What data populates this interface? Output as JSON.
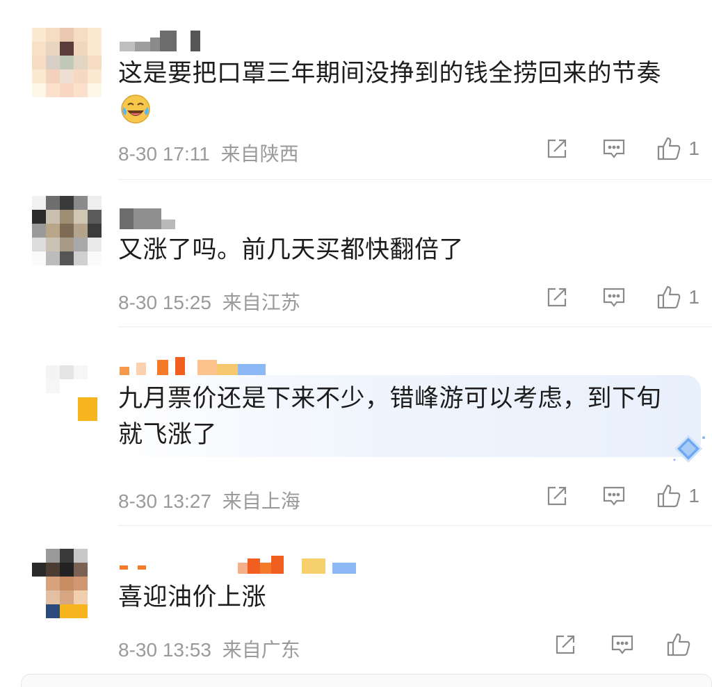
{
  "comments": [
    {
      "text_lines": [
        "这是要把口罩三年期间没挣到的钱全捞回来的节奏"
      ],
      "has_emoji": true,
      "emoji_name": "laugh-cry-emoji",
      "date": "8-30",
      "time": "17:11",
      "location": "来自陕西",
      "like_count": "1"
    },
    {
      "text_lines": [
        "又涨了吗。前几天买都快翻倍了"
      ],
      "date": "8-30",
      "time": "15:25",
      "location": "来自江苏",
      "like_count": "1"
    },
    {
      "text_lines": [
        "九月票价还是下来不少，错峰游可以考虑，到下旬",
        "就飞涨了"
      ],
      "date": "8-30",
      "time": "13:27",
      "location": "来自上海",
      "like_count": "1"
    },
    {
      "text_lines": [
        "喜迎油价上涨"
      ],
      "date": "8-30",
      "time": "13:53",
      "location": "来自广东",
      "like_count": ""
    }
  ],
  "icons": {
    "share": "share-icon",
    "comment": "comment-icon",
    "like": "thumbs-up-icon"
  },
  "colors": {
    "meta_text": "#9a9a9a",
    "icon": "#8a8a8a",
    "highlight": "#e8f0fc"
  }
}
